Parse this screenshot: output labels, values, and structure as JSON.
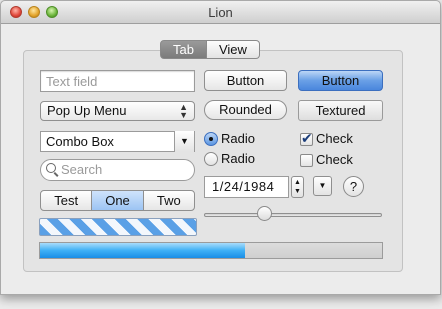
{
  "window": {
    "title": "Lion"
  },
  "tabs": [
    {
      "label": "Tab"
    },
    {
      "label": "View"
    }
  ],
  "text_field": {
    "placeholder": "Text field"
  },
  "buttons": {
    "push": "Button",
    "default": "Button",
    "rounded": "Rounded",
    "textured": "Textured"
  },
  "popup_menu": {
    "value": "Pop Up Menu"
  },
  "combo_box": {
    "value": "Combo Box"
  },
  "search_field": {
    "placeholder": "Search"
  },
  "segmented": {
    "items": [
      "Test",
      "One",
      "Two"
    ],
    "selected": 1
  },
  "radios": [
    {
      "label": "Radio",
      "selected": true
    },
    {
      "label": "Radio",
      "selected": false
    }
  ],
  "checkboxes": [
    {
      "label": "Check",
      "checked": true
    },
    {
      "label": "Check",
      "checked": false
    }
  ],
  "date_picker": {
    "value": "1/24/1984"
  },
  "help_button": {
    "glyph": "?"
  },
  "slider": {
    "value": 0.32
  },
  "progress": {
    "value": 0.6
  },
  "colors": {
    "accent": "#5b96e2",
    "progress_fill": "#3fb0f5"
  }
}
